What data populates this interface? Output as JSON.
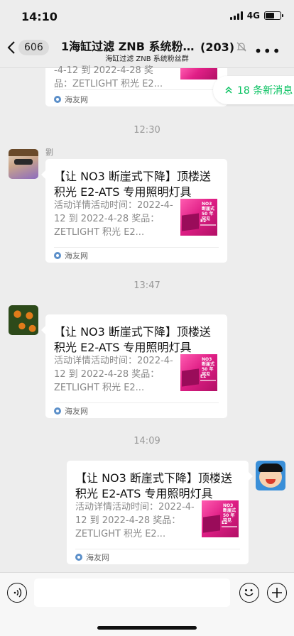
{
  "status_bar": {
    "time": "14:10",
    "network": "4G",
    "battery_level": 0.6
  },
  "nav": {
    "back_count": "606",
    "title": "1海缸过滤 ZNB 系统粉丝群",
    "member_count": "(203)",
    "subtitle": "海缸过滤 ZNB 系统粉丝群",
    "mute_icon": "bell-off-icon",
    "more_icon": "more-dots-icon"
  },
  "new_messages": {
    "label": "18 条新消息",
    "icon": "double-chevron-up-icon"
  },
  "chat": {
    "partial_card": {
      "desc_line": "-4-12 到 2022-4-28 奖",
      "desc_line2": "品：ZETLIGHT 积光 E2...",
      "source": "海友网"
    },
    "messages": [
      {
        "time": "12:30",
        "sender": "劉",
        "card": {
          "title": "【让 NO3 断崖式下降】顶楼送积光 E2-ATS 专用照明灯具",
          "desc": "活动详情活动时间：2022-4-12 到 2022-4-28 奖品：ZETLIGHT 积光 E2...",
          "thumb_text": "NO3 断崖式 50 年罕见",
          "thumb_label": "E2",
          "source": "海友网"
        }
      },
      {
        "time": "13:47",
        "sender": "",
        "card": {
          "title": "【让 NO3 断崖式下降】顶楼送积光 E2-ATS 专用照明灯具",
          "desc": "活动详情活动时间：2022-4-12 到 2022-4-28 奖品：ZETLIGHT 积光 E2...",
          "thumb_text": "NO3 断崖式 50 年罕见",
          "thumb_label": "E2",
          "source": "海友网"
        }
      },
      {
        "time": "14:09",
        "sender": "",
        "card": {
          "title": "【让 NO3 断崖式下降】顶楼送积光 E2-ATS 专用照明灯具",
          "desc": "活动详情活动时间：2022-4-12 到 2022-4-28 奖品：ZETLIGHT 积光 E2...",
          "thumb_text": "NO3 断崖式 50 年罕见",
          "thumb_label": "E2",
          "source": "海友网"
        }
      }
    ]
  },
  "input_bar": {
    "placeholder": ""
  }
}
